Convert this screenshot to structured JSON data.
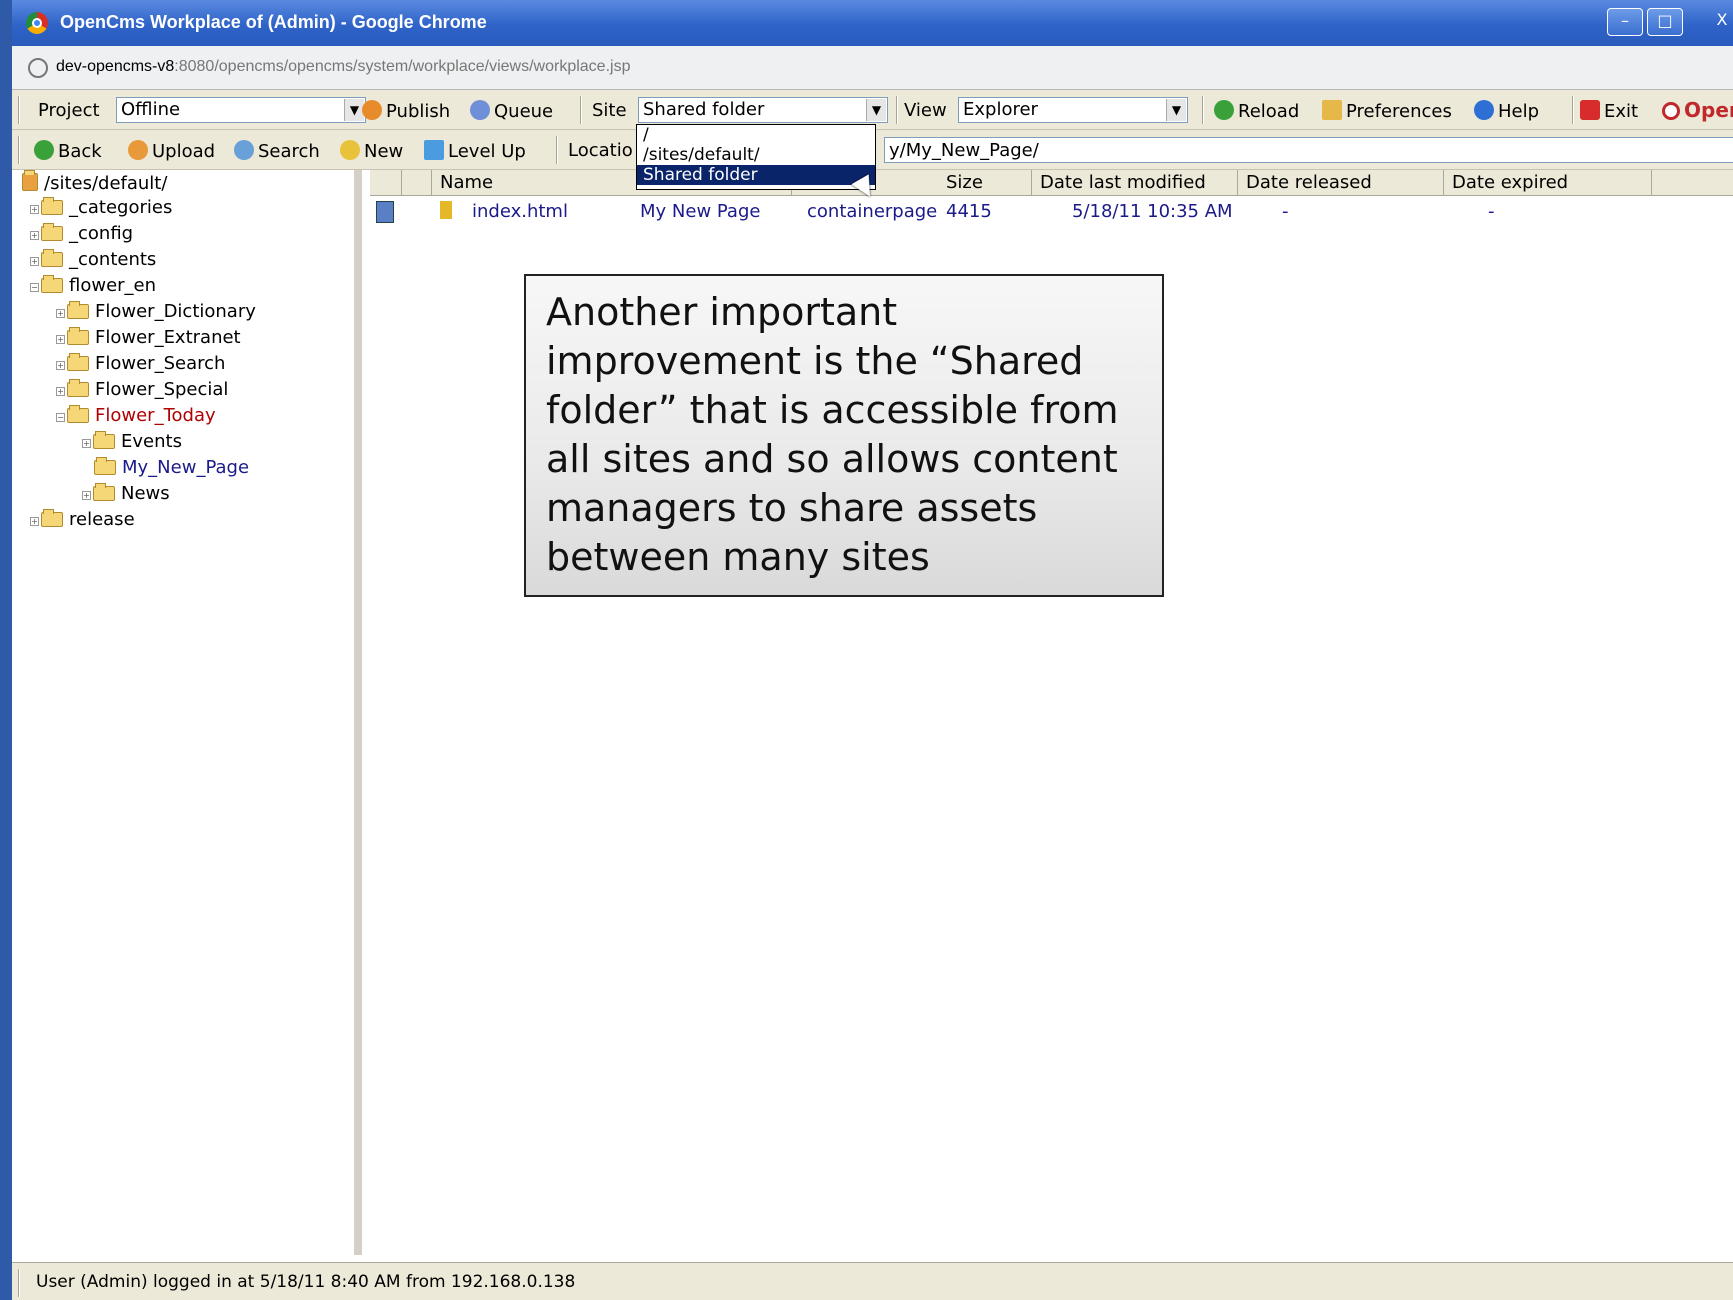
{
  "window": {
    "title": "OpenCms Workplace of (Admin) - Google Chrome",
    "min_glyph": "–",
    "max_glyph": "□",
    "close_glyph": "X"
  },
  "address": {
    "host": "dev-opencms-v8",
    "path": ":8080/opencms/opencms/system/workplace/views/workplace.jsp"
  },
  "toolbar1": {
    "project_label": "Project",
    "project_value": "Offline",
    "publish_label": "Publish",
    "queue_label": "Queue",
    "site_label": "Site",
    "site_value": "Shared folder",
    "view_label": "View",
    "view_value": "Explorer",
    "reload_label": "Reload",
    "preferences_label": "Preferences",
    "help_label": "Help",
    "exit_label": "Exit",
    "logo_text": "Oper"
  },
  "site_dropdown": {
    "options": [
      "/",
      "/sites/default/",
      "Shared folder"
    ],
    "selected": "Shared folder"
  },
  "toolbar2": {
    "back_label": "Back",
    "upload_label": "Upload",
    "search_label": "Search",
    "new_label": "New",
    "levelup_label": "Level Up",
    "location_label": "Locatio",
    "location_value": "y/My_New_Page/"
  },
  "tree": {
    "root": "/sites/default/",
    "items": [
      {
        "label": "_categories"
      },
      {
        "label": "_config"
      },
      {
        "label": "_contents"
      },
      {
        "label": "flower_en"
      },
      {
        "label": "Flower_Dictionary"
      },
      {
        "label": "Flower_Extranet"
      },
      {
        "label": "Flower_Search"
      },
      {
        "label": "Flower_Special"
      },
      {
        "label": "Flower_Today"
      },
      {
        "label": "Events"
      },
      {
        "label": "My_New_Page"
      },
      {
        "label": "News"
      },
      {
        "label": "release"
      }
    ]
  },
  "list": {
    "headers": [
      "Name",
      "Size",
      "Date last modified",
      "Date released",
      "Date expired"
    ],
    "rows": [
      {
        "name": "index.html",
        "title": "My New Page",
        "type": "containerpage",
        "size": "4415",
        "date_modified": "5/18/11 10:35 AM",
        "date_released": "-",
        "date_expired": "-"
      }
    ]
  },
  "callout": {
    "text": "Another important improvement is the “Shared folder” that is accessible from all sites and so allows content managers to share assets between many sites"
  },
  "status": {
    "text": "User (Admin) logged in at 5/18/11 8:40 AM from 192.168.0.138"
  }
}
